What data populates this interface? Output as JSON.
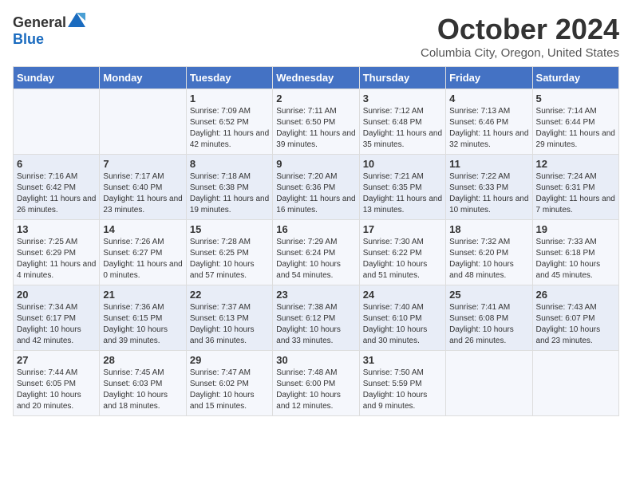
{
  "header": {
    "logo_general": "General",
    "logo_blue": "Blue",
    "title": "October 2024",
    "subtitle": "Columbia City, Oregon, United States"
  },
  "weekdays": [
    "Sunday",
    "Monday",
    "Tuesday",
    "Wednesday",
    "Thursday",
    "Friday",
    "Saturday"
  ],
  "weeks": [
    [
      {
        "day": "",
        "sunrise": "",
        "sunset": "",
        "daylight": ""
      },
      {
        "day": "",
        "sunrise": "",
        "sunset": "",
        "daylight": ""
      },
      {
        "day": "1",
        "sunrise": "Sunrise: 7:09 AM",
        "sunset": "Sunset: 6:52 PM",
        "daylight": "Daylight: 11 hours and 42 minutes."
      },
      {
        "day": "2",
        "sunrise": "Sunrise: 7:11 AM",
        "sunset": "Sunset: 6:50 PM",
        "daylight": "Daylight: 11 hours and 39 minutes."
      },
      {
        "day": "3",
        "sunrise": "Sunrise: 7:12 AM",
        "sunset": "Sunset: 6:48 PM",
        "daylight": "Daylight: 11 hours and 35 minutes."
      },
      {
        "day": "4",
        "sunrise": "Sunrise: 7:13 AM",
        "sunset": "Sunset: 6:46 PM",
        "daylight": "Daylight: 11 hours and 32 minutes."
      },
      {
        "day": "5",
        "sunrise": "Sunrise: 7:14 AM",
        "sunset": "Sunset: 6:44 PM",
        "daylight": "Daylight: 11 hours and 29 minutes."
      }
    ],
    [
      {
        "day": "6",
        "sunrise": "Sunrise: 7:16 AM",
        "sunset": "Sunset: 6:42 PM",
        "daylight": "Daylight: 11 hours and 26 minutes."
      },
      {
        "day": "7",
        "sunrise": "Sunrise: 7:17 AM",
        "sunset": "Sunset: 6:40 PM",
        "daylight": "Daylight: 11 hours and 23 minutes."
      },
      {
        "day": "8",
        "sunrise": "Sunrise: 7:18 AM",
        "sunset": "Sunset: 6:38 PM",
        "daylight": "Daylight: 11 hours and 19 minutes."
      },
      {
        "day": "9",
        "sunrise": "Sunrise: 7:20 AM",
        "sunset": "Sunset: 6:36 PM",
        "daylight": "Daylight: 11 hours and 16 minutes."
      },
      {
        "day": "10",
        "sunrise": "Sunrise: 7:21 AM",
        "sunset": "Sunset: 6:35 PM",
        "daylight": "Daylight: 11 hours and 13 minutes."
      },
      {
        "day": "11",
        "sunrise": "Sunrise: 7:22 AM",
        "sunset": "Sunset: 6:33 PM",
        "daylight": "Daylight: 11 hours and 10 minutes."
      },
      {
        "day": "12",
        "sunrise": "Sunrise: 7:24 AM",
        "sunset": "Sunset: 6:31 PM",
        "daylight": "Daylight: 11 hours and 7 minutes."
      }
    ],
    [
      {
        "day": "13",
        "sunrise": "Sunrise: 7:25 AM",
        "sunset": "Sunset: 6:29 PM",
        "daylight": "Daylight: 11 hours and 4 minutes."
      },
      {
        "day": "14",
        "sunrise": "Sunrise: 7:26 AM",
        "sunset": "Sunset: 6:27 PM",
        "daylight": "Daylight: 11 hours and 0 minutes."
      },
      {
        "day": "15",
        "sunrise": "Sunrise: 7:28 AM",
        "sunset": "Sunset: 6:25 PM",
        "daylight": "Daylight: 10 hours and 57 minutes."
      },
      {
        "day": "16",
        "sunrise": "Sunrise: 7:29 AM",
        "sunset": "Sunset: 6:24 PM",
        "daylight": "Daylight: 10 hours and 54 minutes."
      },
      {
        "day": "17",
        "sunrise": "Sunrise: 7:30 AM",
        "sunset": "Sunset: 6:22 PM",
        "daylight": "Daylight: 10 hours and 51 minutes."
      },
      {
        "day": "18",
        "sunrise": "Sunrise: 7:32 AM",
        "sunset": "Sunset: 6:20 PM",
        "daylight": "Daylight: 10 hours and 48 minutes."
      },
      {
        "day": "19",
        "sunrise": "Sunrise: 7:33 AM",
        "sunset": "Sunset: 6:18 PM",
        "daylight": "Daylight: 10 hours and 45 minutes."
      }
    ],
    [
      {
        "day": "20",
        "sunrise": "Sunrise: 7:34 AM",
        "sunset": "Sunset: 6:17 PM",
        "daylight": "Daylight: 10 hours and 42 minutes."
      },
      {
        "day": "21",
        "sunrise": "Sunrise: 7:36 AM",
        "sunset": "Sunset: 6:15 PM",
        "daylight": "Daylight: 10 hours and 39 minutes."
      },
      {
        "day": "22",
        "sunrise": "Sunrise: 7:37 AM",
        "sunset": "Sunset: 6:13 PM",
        "daylight": "Daylight: 10 hours and 36 minutes."
      },
      {
        "day": "23",
        "sunrise": "Sunrise: 7:38 AM",
        "sunset": "Sunset: 6:12 PM",
        "daylight": "Daylight: 10 hours and 33 minutes."
      },
      {
        "day": "24",
        "sunrise": "Sunrise: 7:40 AM",
        "sunset": "Sunset: 6:10 PM",
        "daylight": "Daylight: 10 hours and 30 minutes."
      },
      {
        "day": "25",
        "sunrise": "Sunrise: 7:41 AM",
        "sunset": "Sunset: 6:08 PM",
        "daylight": "Daylight: 10 hours and 26 minutes."
      },
      {
        "day": "26",
        "sunrise": "Sunrise: 7:43 AM",
        "sunset": "Sunset: 6:07 PM",
        "daylight": "Daylight: 10 hours and 23 minutes."
      }
    ],
    [
      {
        "day": "27",
        "sunrise": "Sunrise: 7:44 AM",
        "sunset": "Sunset: 6:05 PM",
        "daylight": "Daylight: 10 hours and 20 minutes."
      },
      {
        "day": "28",
        "sunrise": "Sunrise: 7:45 AM",
        "sunset": "Sunset: 6:03 PM",
        "daylight": "Daylight: 10 hours and 18 minutes."
      },
      {
        "day": "29",
        "sunrise": "Sunrise: 7:47 AM",
        "sunset": "Sunset: 6:02 PM",
        "daylight": "Daylight: 10 hours and 15 minutes."
      },
      {
        "day": "30",
        "sunrise": "Sunrise: 7:48 AM",
        "sunset": "Sunset: 6:00 PM",
        "daylight": "Daylight: 10 hours and 12 minutes."
      },
      {
        "day": "31",
        "sunrise": "Sunrise: 7:50 AM",
        "sunset": "Sunset: 5:59 PM",
        "daylight": "Daylight: 10 hours and 9 minutes."
      },
      {
        "day": "",
        "sunrise": "",
        "sunset": "",
        "daylight": ""
      },
      {
        "day": "",
        "sunrise": "",
        "sunset": "",
        "daylight": ""
      }
    ]
  ]
}
